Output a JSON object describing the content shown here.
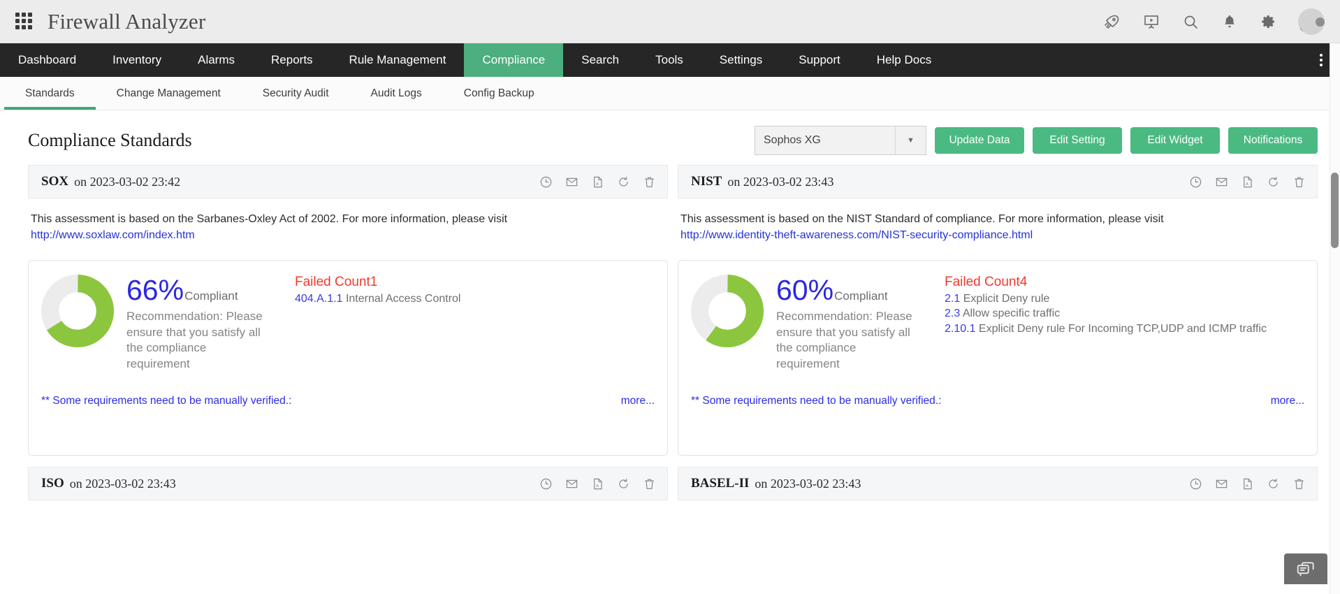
{
  "topbar": {
    "app_title": "Firewall Analyzer",
    "grid_icon": "app-grid-icon",
    "icons": [
      {
        "name": "rocket-icon",
        "label": "Rocket"
      },
      {
        "name": "presentation-icon",
        "label": "Demo"
      },
      {
        "name": "search-icon",
        "label": "Search"
      },
      {
        "name": "bell-icon",
        "label": "Notifications"
      },
      {
        "name": "gear-icon",
        "label": "Settings"
      },
      {
        "name": "avatar",
        "label": "Profile"
      }
    ]
  },
  "mainnav": {
    "items": [
      {
        "label": "Dashboard",
        "active": false
      },
      {
        "label": "Inventory",
        "active": false
      },
      {
        "label": "Alarms",
        "active": false
      },
      {
        "label": "Reports",
        "active": false
      },
      {
        "label": "Rule Management",
        "active": false
      },
      {
        "label": "Compliance",
        "active": true
      },
      {
        "label": "Search",
        "active": false
      },
      {
        "label": "Tools",
        "active": false
      },
      {
        "label": "Settings",
        "active": false
      },
      {
        "label": "Support",
        "active": false
      },
      {
        "label": "Help Docs",
        "active": false
      }
    ],
    "active_color": "#4caf7d"
  },
  "subnav": {
    "items": [
      {
        "label": "Standards",
        "active": true
      },
      {
        "label": "Change Management",
        "active": false
      },
      {
        "label": "Security Audit",
        "active": false
      },
      {
        "label": "Audit Logs",
        "active": false
      },
      {
        "label": "Config Backup",
        "active": false
      }
    ],
    "active_underline_color": "#3ca96f"
  },
  "pagehead": {
    "title": "Compliance Standards",
    "device_select": {
      "value": "Sophos XG",
      "options": [
        "Sophos XG"
      ]
    },
    "buttons": [
      {
        "label": "Update Data",
        "name": "update-data-button"
      },
      {
        "label": "Edit Setting",
        "name": "edit-setting-button"
      },
      {
        "label": "Edit Widget",
        "name": "edit-widget-button"
      },
      {
        "label": "Notifications",
        "name": "notifications-button"
      }
    ],
    "button_color": "#4aba82"
  },
  "card_icons": [
    {
      "name": "schedule-clock-icon"
    },
    {
      "name": "mail-icon"
    },
    {
      "name": "pdf-icon"
    },
    {
      "name": "refresh-icon"
    },
    {
      "name": "trash-icon"
    }
  ],
  "cards": [
    {
      "standard": "SOX",
      "on_label": "on",
      "timestamp": "2023-03-02 23:42",
      "description": "This assessment is based on the Sarbanes-Oxley Act of 2002. For more information, please visit",
      "link": "http://www.soxlaw.com/index.htm",
      "percent": "66%",
      "percent_value": 66,
      "compliant_label": "Compliant",
      "recommendation": "Recommendation: Please ensure that you satisfy all the compliance requirement",
      "failed_title": "Failed Count1",
      "failed_count": 1,
      "failures": [
        {
          "code": "404.A.1.1",
          "text": " Internal Access Control"
        }
      ],
      "note": "** Some requirements need to be manually verified.:",
      "more": "more..."
    },
    {
      "standard": "NIST",
      "on_label": "on",
      "timestamp": "2023-03-02 23:43",
      "description": "This assessment is based on the NIST Standard of compliance. For more information, please visit",
      "link": "http://www.identity-theft-awareness.com/NIST-security-compliance.html",
      "percent": "60%",
      "percent_value": 60,
      "compliant_label": "Compliant",
      "recommendation": "Recommendation: Please ensure that you satisfy all the compliance requirement",
      "failed_title": "Failed Count4",
      "failed_count": 4,
      "failures": [
        {
          "code": "2.1",
          "text": " Explicit Deny rule"
        },
        {
          "code": "2.3",
          "text": " Allow specific traffic"
        },
        {
          "code": "2.10.1",
          "text": " Explicit Deny rule For Incoming TCP,UDP and ICMP traffic"
        }
      ],
      "note": "** Some requirements need to be manually verified.:",
      "more": "more..."
    }
  ],
  "cards_row2": [
    {
      "standard": "ISO",
      "on_label": "on",
      "timestamp": "2023-03-02 23:43"
    },
    {
      "standard": "BASEL-II",
      "on_label": "on",
      "timestamp": "2023-03-02 23:43"
    }
  ],
  "chart_data": [
    {
      "type": "pie",
      "title": "SOX Compliance",
      "labels": [
        "Compliant",
        "Non-compliant"
      ],
      "values": [
        66,
        34
      ],
      "colors": [
        "#8cc63e",
        "#ececec"
      ],
      "donut": true
    },
    {
      "type": "pie",
      "title": "NIST Compliance",
      "labels": [
        "Compliant",
        "Non-compliant"
      ],
      "values": [
        60,
        40
      ],
      "colors": [
        "#8cc63e",
        "#ececec"
      ],
      "donut": true
    }
  ],
  "chat_widget": {
    "name": "chat-widget-button"
  }
}
